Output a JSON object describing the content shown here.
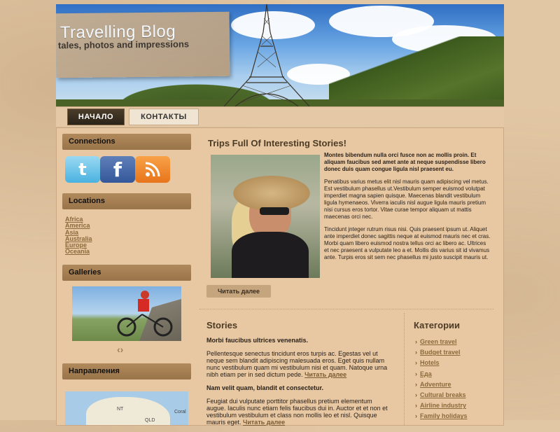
{
  "header": {
    "title": "Travelling Blog",
    "subtitle": "tales, photos and impressions"
  },
  "nav": {
    "items": [
      {
        "label": "НАЧАЛО",
        "active": true
      },
      {
        "label": "КОНТАКТЫ",
        "active": false
      }
    ]
  },
  "sidebar": {
    "connections": {
      "title": "Connections",
      "icons": [
        "twitter-icon",
        "facebook-icon",
        "rss-icon"
      ]
    },
    "locations": {
      "title": "Locations",
      "items": [
        "Africa",
        "America",
        "Asia",
        "Australia",
        "Europe",
        "Oceania"
      ]
    },
    "galleries": {
      "title": "Galleries"
    },
    "directions": {
      "title": "Направления",
      "map_labels": [
        "NT",
        "QLD",
        "Coral"
      ]
    }
  },
  "post": {
    "title": "Trips Full Of Interesting Stories!",
    "lead": "Montes bibendum nulla orci fusce non ac mollis proin. Et aliquam faucibus sed amet ante at neque suspendisse libero donec duis quam congue ligula nisl praesent eu.",
    "p1": "Penatibus varius metus elit nisl mauris quam adipiscing vel metus. Est vestibulum phasellus ut.Vestibulum semper euismod volutpat imperdiet magna sapien quisque. Maecenas blandit vestibulum ligula hymenaeos. Viverra iaculis nisl augue ligula mauris pretium nisi cursus eros tortor. Vitae curae tempor aliquam ut mattis maecenas orci nec.",
    "p2": "Tincidunt jnteger rutrum risus nisi. Quis praesent ipsum ut. Aliquet ante imperdiet donec sagittis neque at euismod mauris nec et cras. Morbi quam libero euismod nostra tellus orci ac libero ac. Ultrices et nec praesent a vulputate leo a et. Mollis dis varius sit id vivamus ante. Turpis eros sit sem nec phasellus mi justo suscipit mauris ut.",
    "read_more": "Читать далее"
  },
  "stories": {
    "title": "Stories",
    "items": [
      {
        "heading": "Morbi faucibus ultrices venenatis.",
        "text": "Pellentesque senectus tincidunt eros turpis ac. Egestas vel ut neque sem blandit adipiscing malesuada eros. Eget quis nullam nunc vestibulum quam mi vestibulum nisi et quam. Natoque urna nibh etiam per in sed dictum pede.",
        "more": "Читать далее"
      },
      {
        "heading": "Nam velit quam, blandit et consectetur.",
        "text": "Feugiat dui vulputate porttitor phasellus pretium elementum augue. Iaculis nunc etiam felis faucibus dui in. Auctor et et non et vestibulum vestibulum et class non mollis leo et nisl. Quisque mauris eget.",
        "more": "Читать далее"
      }
    ]
  },
  "categories": {
    "title": "Категории",
    "items": [
      "Green travel",
      "Budget travel",
      "Hotels",
      "Еда",
      "Adventure",
      "Cultural breaks",
      "Airline industry",
      "Family holidays"
    ]
  }
}
